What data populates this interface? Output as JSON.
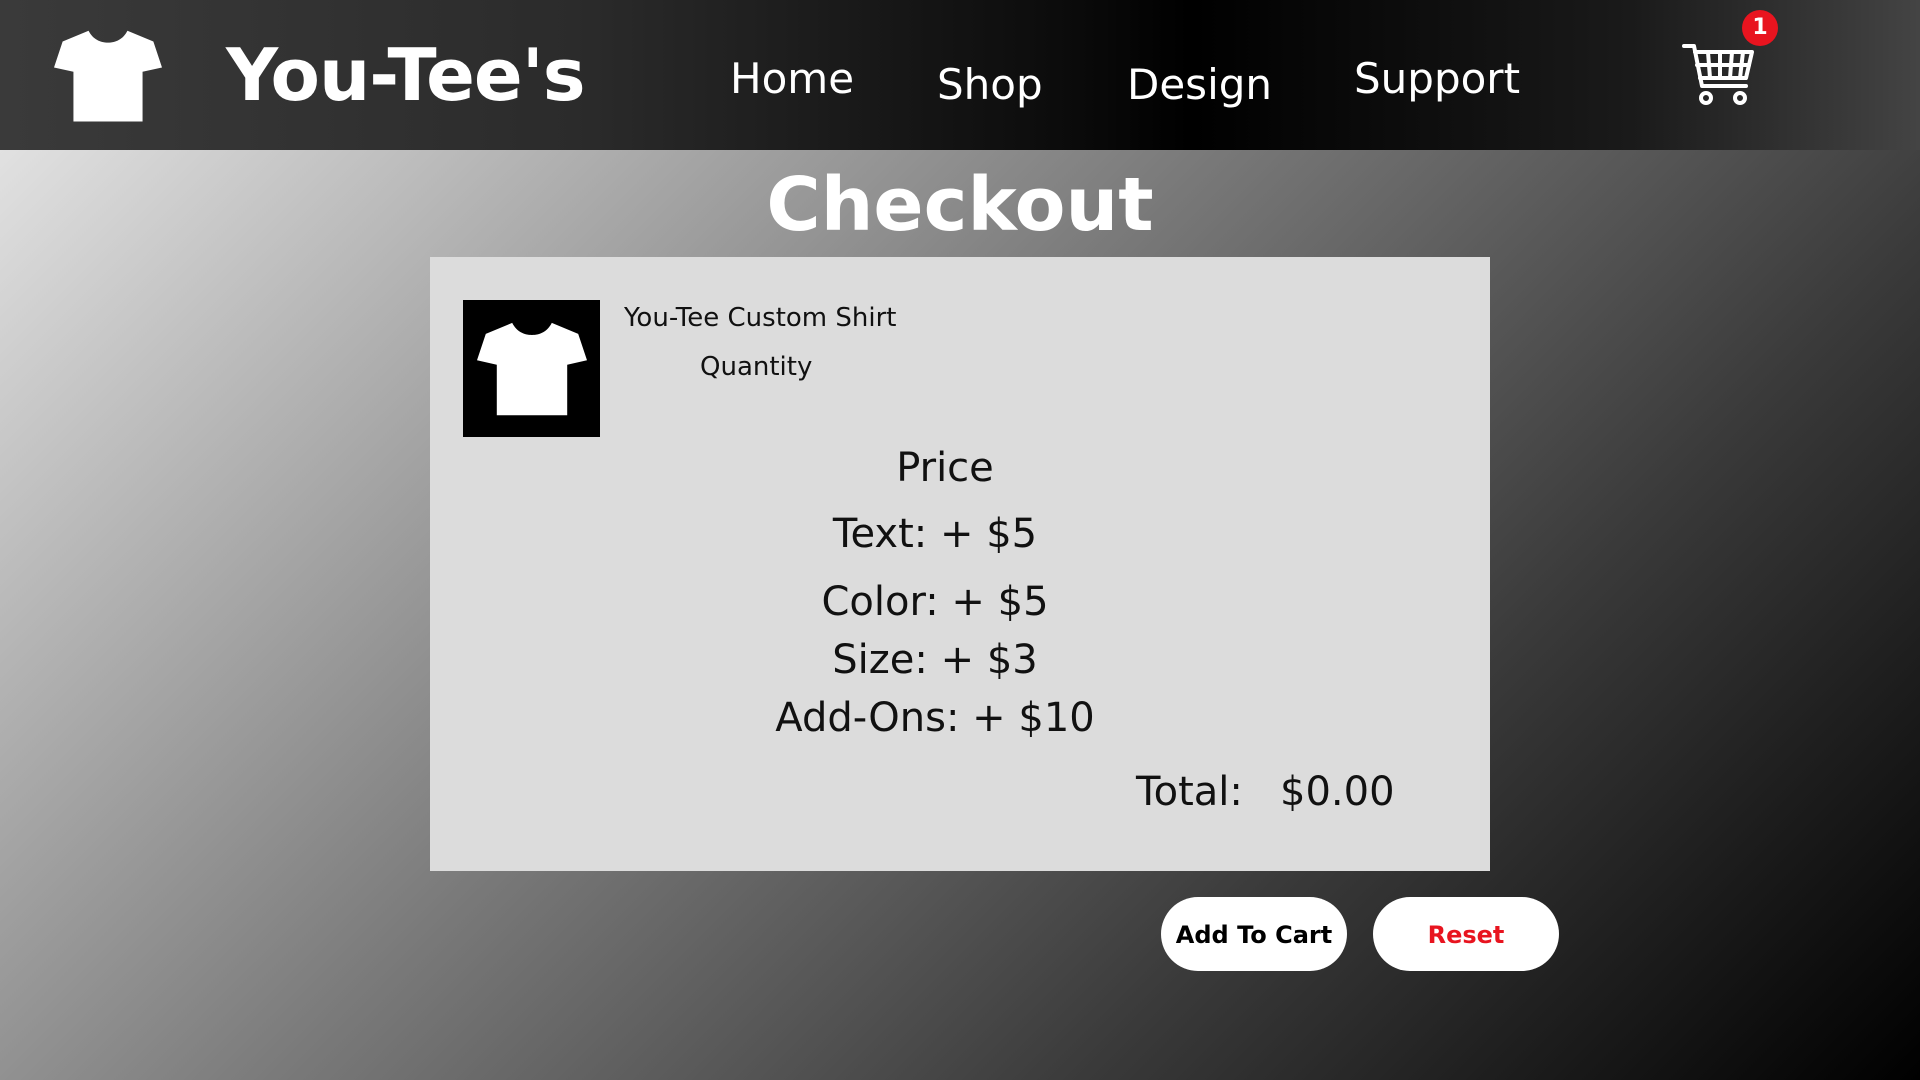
{
  "header": {
    "brand": "You-Tee's",
    "nav": {
      "home": "Home",
      "shop": "Shop",
      "design": "Design",
      "support": "Support"
    },
    "cart_count": "1",
    "logo_icon": "tshirt-icon",
    "cart_icon": "shopping-cart-icon"
  },
  "page": {
    "title": "Checkout"
  },
  "item": {
    "name": "You-Tee Custom Shirt",
    "quantity_label": "Quantity",
    "thumbnail_icon": "tshirt-icon"
  },
  "pricing": {
    "heading": "Price",
    "text": "Text: + $5",
    "color": "Color: + $5",
    "size": "Size: + $3",
    "addons": "Add-Ons: + $10",
    "total_label": "Total:",
    "total_value": "$0.00"
  },
  "actions": {
    "add_to_cart": "Add To Cart",
    "reset": "Reset"
  },
  "colors": {
    "accent_red": "#e8141f",
    "card_bg": "#dcdcdc"
  }
}
